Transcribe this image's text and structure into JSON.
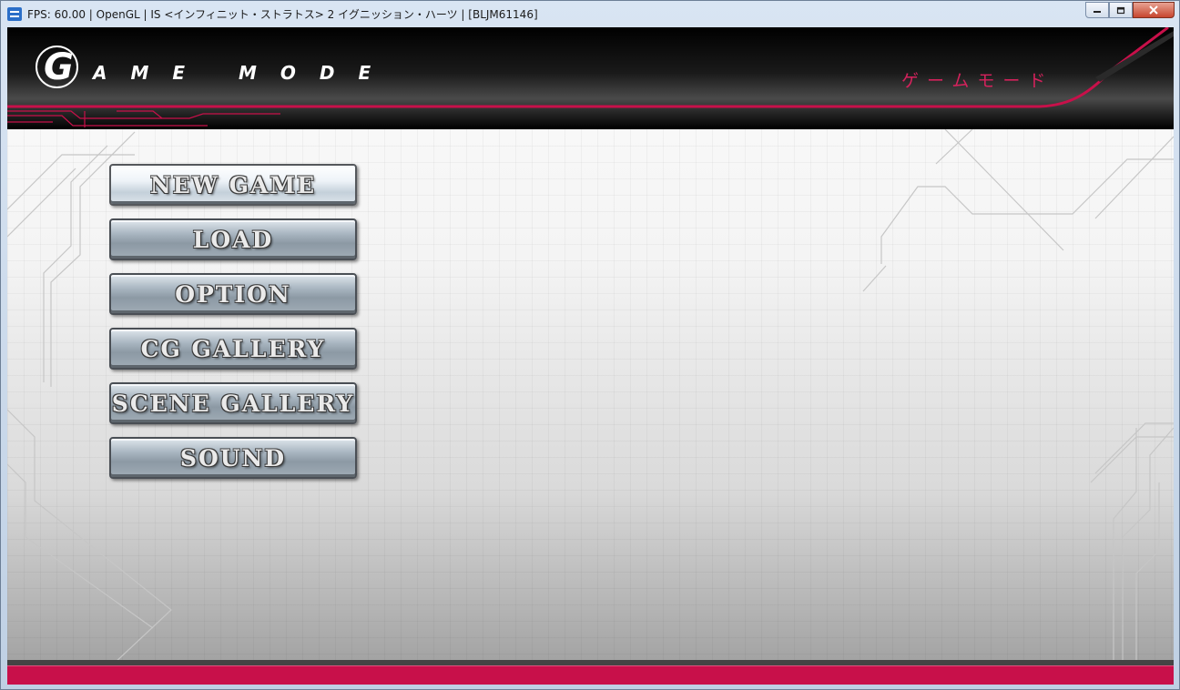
{
  "window": {
    "title": "FPS: 60.00 | OpenGL | IS <インフィニット・ストラトス> 2 イグニッション・ハーツ | [BLJM61146]"
  },
  "header": {
    "logo_letter": "G",
    "logo_text": "AME MODE",
    "japanese_title": "ゲームモード"
  },
  "menu": {
    "items": [
      {
        "label": "NEW GAME",
        "selected": true
      },
      {
        "label": "LOAD",
        "selected": false
      },
      {
        "label": "OPTION",
        "selected": false
      },
      {
        "label": "CG GALLERY",
        "selected": false
      },
      {
        "label": "SCENE GALLERY",
        "selected": false
      },
      {
        "label": "SOUND",
        "selected": false
      }
    ]
  },
  "colors": {
    "accent": "#c8104a",
    "header_bg": "#000000"
  }
}
